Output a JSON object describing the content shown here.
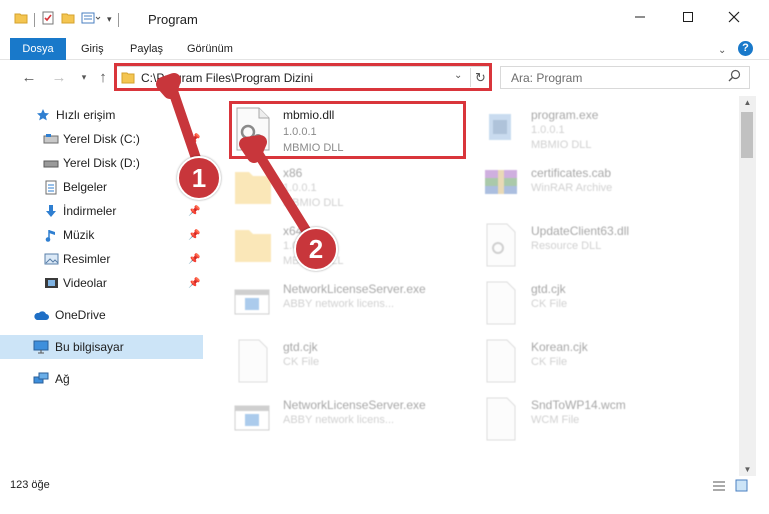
{
  "window": {
    "title": "Program",
    "minimize_icon": "minimize-icon",
    "maximize_icon": "maximize-icon",
    "close_icon": "close-icon"
  },
  "ribbon": {
    "tabs": [
      {
        "label": "Dosya",
        "active": true
      },
      {
        "label": "Giriş",
        "active": false
      },
      {
        "label": "Paylaş",
        "active": false
      },
      {
        "label": "Görünüm",
        "active": false
      }
    ],
    "help_icon": "?"
  },
  "address": {
    "path": "C:\\Program Files\\Program Dizini",
    "search_placeholder": "Ara: Program"
  },
  "sidebar": {
    "items": [
      {
        "label": "Hızlı erişim",
        "icon": "star-icon",
        "pinned": false
      },
      {
        "label": "Yerel Disk (C:)",
        "icon": "drive-icon",
        "pinned": true
      },
      {
        "label": "Yerel Disk (D:)",
        "icon": "drive-icon",
        "pinned": false
      },
      {
        "label": "Belgeler",
        "icon": "documents-icon",
        "pinned": false
      },
      {
        "label": "İndirmeler",
        "icon": "download-icon",
        "pinned": true
      },
      {
        "label": "Müzik",
        "icon": "music-icon",
        "pinned": true
      },
      {
        "label": "Resimler",
        "icon": "pictures-icon",
        "pinned": true
      },
      {
        "label": "Videolar",
        "icon": "videos-icon",
        "pinned": true
      },
      {
        "label": "OneDrive",
        "icon": "cloud-icon",
        "pinned": false
      },
      {
        "label": "Bu bilgisayar",
        "icon": "computer-icon",
        "pinned": false,
        "selected": true
      },
      {
        "label": "Ağ",
        "icon": "network-icon",
        "pinned": false
      }
    ]
  },
  "files": [
    {
      "name": "mbmio.dll",
      "line2": "1.0.0.1",
      "line3": "MBMIO DLL",
      "type": "dll",
      "highlighted": true
    },
    {
      "name": "program.exe",
      "line2": "1.0.0.1",
      "line3": "MBMIO DLL",
      "type": "exe"
    },
    {
      "name": "x86",
      "line2": "1.0.0.1",
      "line3": "MBMIO DLL",
      "type": "folder"
    },
    {
      "name": "certificates.cab",
      "line2": "WinRAR Archive",
      "line3": "",
      "type": "archive"
    },
    {
      "name": "x64",
      "line2": "1.0.0.1",
      "line3": "MBMIO DLL",
      "type": "folder"
    },
    {
      "name": "UpdateClient63.dll",
      "line2": "Resource DLL",
      "line3": "",
      "type": "dll"
    },
    {
      "name": "NetworkLicenseServer.exe",
      "line2": "ABBY network licens...",
      "line3": "",
      "type": "exe-window"
    },
    {
      "name": "gtd.cjk",
      "line2": "CK File",
      "line3": "",
      "type": "doc"
    },
    {
      "name": "gtd.cjk",
      "line2": "CK File",
      "line3": "",
      "type": "doc"
    },
    {
      "name": "Korean.cjk",
      "line2": "CK File",
      "line3": "",
      "type": "doc"
    },
    {
      "name": "NetworkLicenseServer.exe",
      "line2": "ABBY network licens...",
      "line3": "",
      "type": "exe-window"
    },
    {
      "name": "SndToWP14.wcm",
      "line2": "WCM File",
      "line3": "",
      "type": "doc"
    }
  ],
  "status": {
    "count": "123 öğe"
  },
  "annotations": {
    "step1": "1",
    "step2": "2",
    "color": "#c8363b"
  }
}
